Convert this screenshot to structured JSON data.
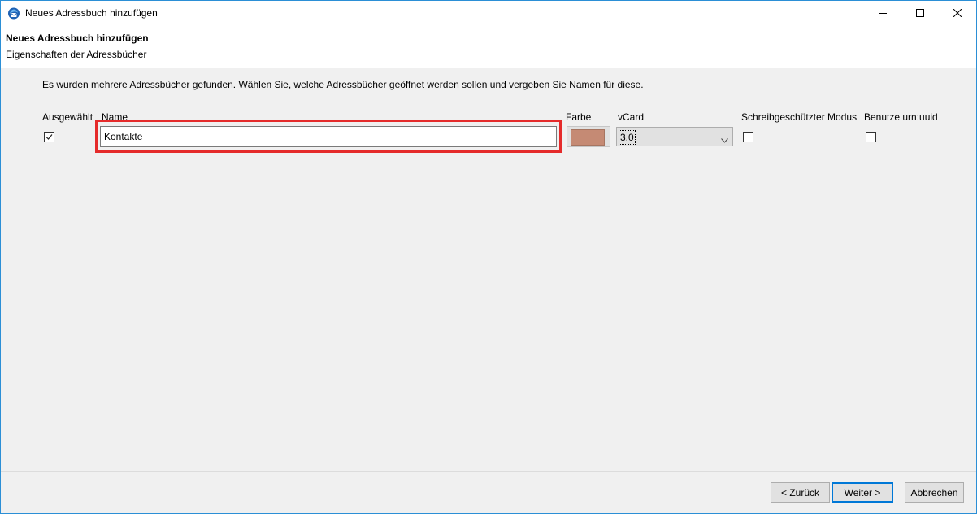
{
  "window": {
    "title": "Neues Adressbuch hinzufügen",
    "icons": {
      "app": "thunderbird-icon",
      "minimize": "minimize-icon",
      "maximize": "maximize-icon",
      "close": "close-icon"
    }
  },
  "header": {
    "title": "Neues Adressbuch hinzufügen",
    "subtitle": "Eigenschaften der Adressbücher"
  },
  "intro": "Es wurden mehrere Adressbücher gefunden. Wählen Sie, welche Adressbücher geöffnet werden sollen und vergeben Sie Namen für diese.",
  "columns": {
    "selected": "Ausgewählt",
    "name": "Name",
    "color": "Farbe",
    "vcard": "vCard",
    "readonly": "Schreibgeschützter Modus",
    "urn_uuid": "Benutze urn:uuid"
  },
  "rows": [
    {
      "selected": true,
      "name": "Kontakte",
      "color": "#c58a74",
      "vcard": "3.0",
      "readonly": false,
      "urn_uuid": false
    }
  ],
  "accent": {
    "highlight": "#e52b2b",
    "focus": "#0078d7"
  },
  "buttons": {
    "back": "< Zurück",
    "next": "Weiter >",
    "cancel": "Abbrechen"
  }
}
